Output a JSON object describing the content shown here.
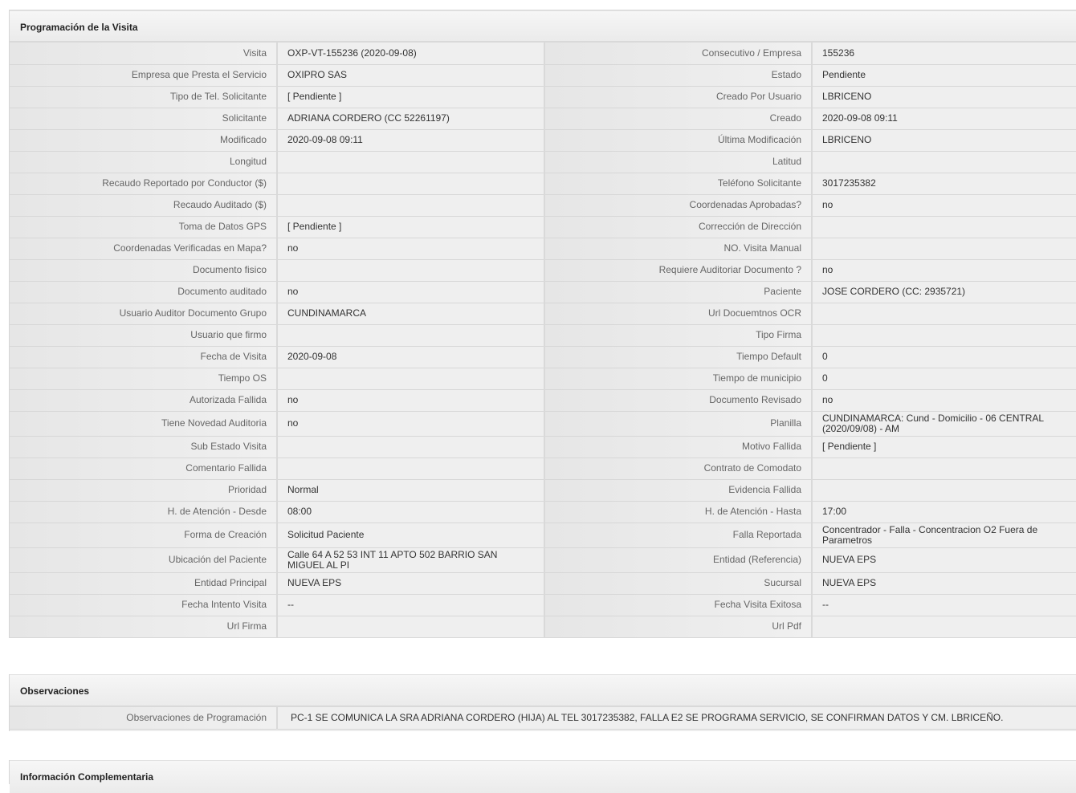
{
  "sections": {
    "programacion": "Programación de la Visita",
    "observaciones": "Observaciones",
    "complementaria": "Información Complementaria"
  },
  "rows": [
    {
      "l1": "Visita",
      "v1": "OXP-VT-155236 (2020-09-08)",
      "l2": "Consecutivo / Empresa",
      "v2": "155236"
    },
    {
      "l1": "Empresa que Presta el Servicio",
      "v1": "OXIPRO SAS",
      "l2": "Estado",
      "v2": "Pendiente"
    },
    {
      "l1": "Tipo de Tel. Solicitante",
      "v1": "[ Pendiente ]",
      "l2": "Creado Por Usuario",
      "v2": "LBRICENO"
    },
    {
      "l1": "Solicitante",
      "v1": "ADRIANA CORDERO (CC 52261197)",
      "l2": "Creado",
      "v2": "2020-09-08 09:11"
    },
    {
      "l1": "Modificado",
      "v1": "2020-09-08 09:11",
      "l2": "Última Modificación",
      "v2": " LBRICENO"
    },
    {
      "l1": "Longitud",
      "v1": "",
      "l2": "Latitud",
      "v2": ""
    },
    {
      "l1": "Recaudo Reportado por Conductor ($)",
      "v1": "",
      "l2": "Teléfono Solicitante",
      "v2": "3017235382"
    },
    {
      "l1": "Recaudo Auditado ($)",
      "v1": "",
      "l2": "Coordenadas Aprobadas?",
      "v2": " no"
    },
    {
      "l1": "Toma de Datos GPS",
      "v1": "[ Pendiente ]",
      "l2": "Corrección de Dirección",
      "v2": ""
    },
    {
      "l1": "Coordenadas Verificadas en Mapa?",
      "v1": " no",
      "l2": "NO. Visita Manual",
      "v2": ""
    },
    {
      "l1": "Documento fisico",
      "v1": "",
      "l2": "Requiere Auditoriar Documento ?",
      "v2": " no"
    },
    {
      "l1": "Documento auditado",
      "v1": " no",
      "l2": "Paciente",
      "v2": "JOSE CORDERO (CC: 2935721)"
    },
    {
      "l1": "Usuario Auditor Documento Grupo",
      "v1": "CUNDINAMARCA",
      "l2": "Url Docuemtnos OCR",
      "v2": ""
    },
    {
      "l1": "Usuario que firmo",
      "v1": "",
      "l2": "Tipo Firma",
      "v2": ""
    },
    {
      "l1": "Fecha de Visita",
      "v1": " 2020-09-08",
      "l2": "Tiempo Default",
      "v2": "0"
    },
    {
      "l1": "Tiempo OS",
      "v1": "",
      "l2": "Tiempo de municipio",
      "v2": "0"
    },
    {
      "l1": "Autorizada Fallida",
      "v1": " no",
      "l2": "Documento Revisado",
      "v2": " no"
    },
    {
      "l1": "Tiene Novedad Auditoria",
      "v1": " no",
      "l2": "Planilla",
      "v2": "CUNDINAMARCA: Cund - Domicilio - 06 CENTRAL (2020/09/08) - AM",
      "tall": true
    },
    {
      "l1": "Sub Estado Visita",
      "v1": "",
      "l2": "Motivo Fallida",
      "v2": "[ Pendiente ]"
    },
    {
      "l1": "Comentario Fallida",
      "v1": "",
      "l2": "Contrato de Comodato",
      "v2": ""
    },
    {
      "l1": "Prioridad",
      "v1": "Normal",
      "l2": "Evidencia Fallida",
      "v2": ""
    },
    {
      "l1": "H. de Atención - Desde",
      "v1": "08:00",
      "l2": "H. de Atención - Hasta",
      "v2": "17:00"
    },
    {
      "l1": "Forma de Creación",
      "v1": "Solicitud Paciente",
      "l2": "Falla Reportada",
      "v2": "Concentrador - Falla - Concentracion O2 Fuera de Parametros",
      "tall": true
    },
    {
      "l1": "Ubicación del Paciente",
      "v1": "Calle 64 A 52 53 INT 11 APTO 502 BARRIO SAN MIGUEL AL PI",
      "l2": "Entidad (Referencia)",
      "v2": "NUEVA EPS",
      "tall": true
    },
    {
      "l1": "Entidad Principal",
      "v1": "NUEVA EPS",
      "l2": "Sucursal",
      "v2": "NUEVA EPS"
    },
    {
      "l1": "Fecha Intento Visita",
      "v1": "--",
      "l2": "Fecha Visita Exitosa",
      "v2": "--"
    },
    {
      "l1": "Url Firma",
      "v1": "",
      "l2": "Url Pdf",
      "v2": ""
    }
  ],
  "observaciones": {
    "label": "Observaciones de Programación",
    "value": "PC-1 SE COMUNICA LA SRA ADRIANA CORDERO (HIJA) AL TEL 3017235382, FALLA E2 SE PROGRAMA SERVICIO, SE CONFIRMAN DATOS Y CM. LBRICEÑO."
  }
}
